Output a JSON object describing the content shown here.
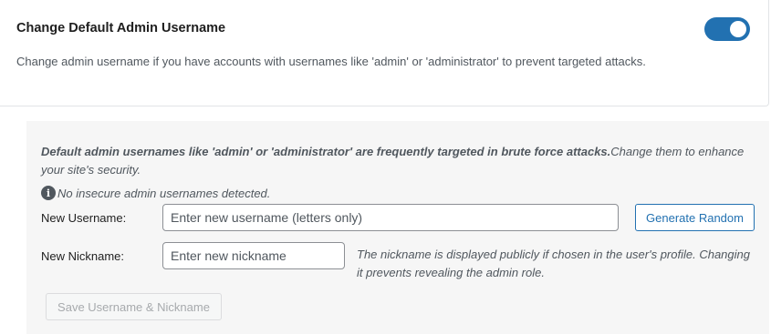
{
  "card": {
    "title": "Change Default Admin Username",
    "description": "Change admin username if you have accounts with usernames like 'admin' or 'administrator' to prevent targeted attacks.",
    "toggle_on": true,
    "accent_color": "#2271b1"
  },
  "panel": {
    "notice_bold": "Default admin usernames like 'admin' or 'administrator' are frequently targeted in brute force attacks.",
    "notice_rest": "Change them to enhance your site's security.",
    "status_icon": "info-icon",
    "status_text": "No insecure admin usernames detected.",
    "username_label": "New Username:",
    "username_placeholder": "Enter new username (letters only)",
    "username_value": "",
    "generate_button": "Generate Random",
    "nickname_label": "New Nickname:",
    "nickname_placeholder": "Enter new nickname",
    "nickname_value": "",
    "nickname_hint": "The nickname is displayed publicly if chosen in the user's profile. Changing it prevents revealing the admin role.",
    "save_button": "Save Username & Nickname",
    "save_disabled": true
  }
}
